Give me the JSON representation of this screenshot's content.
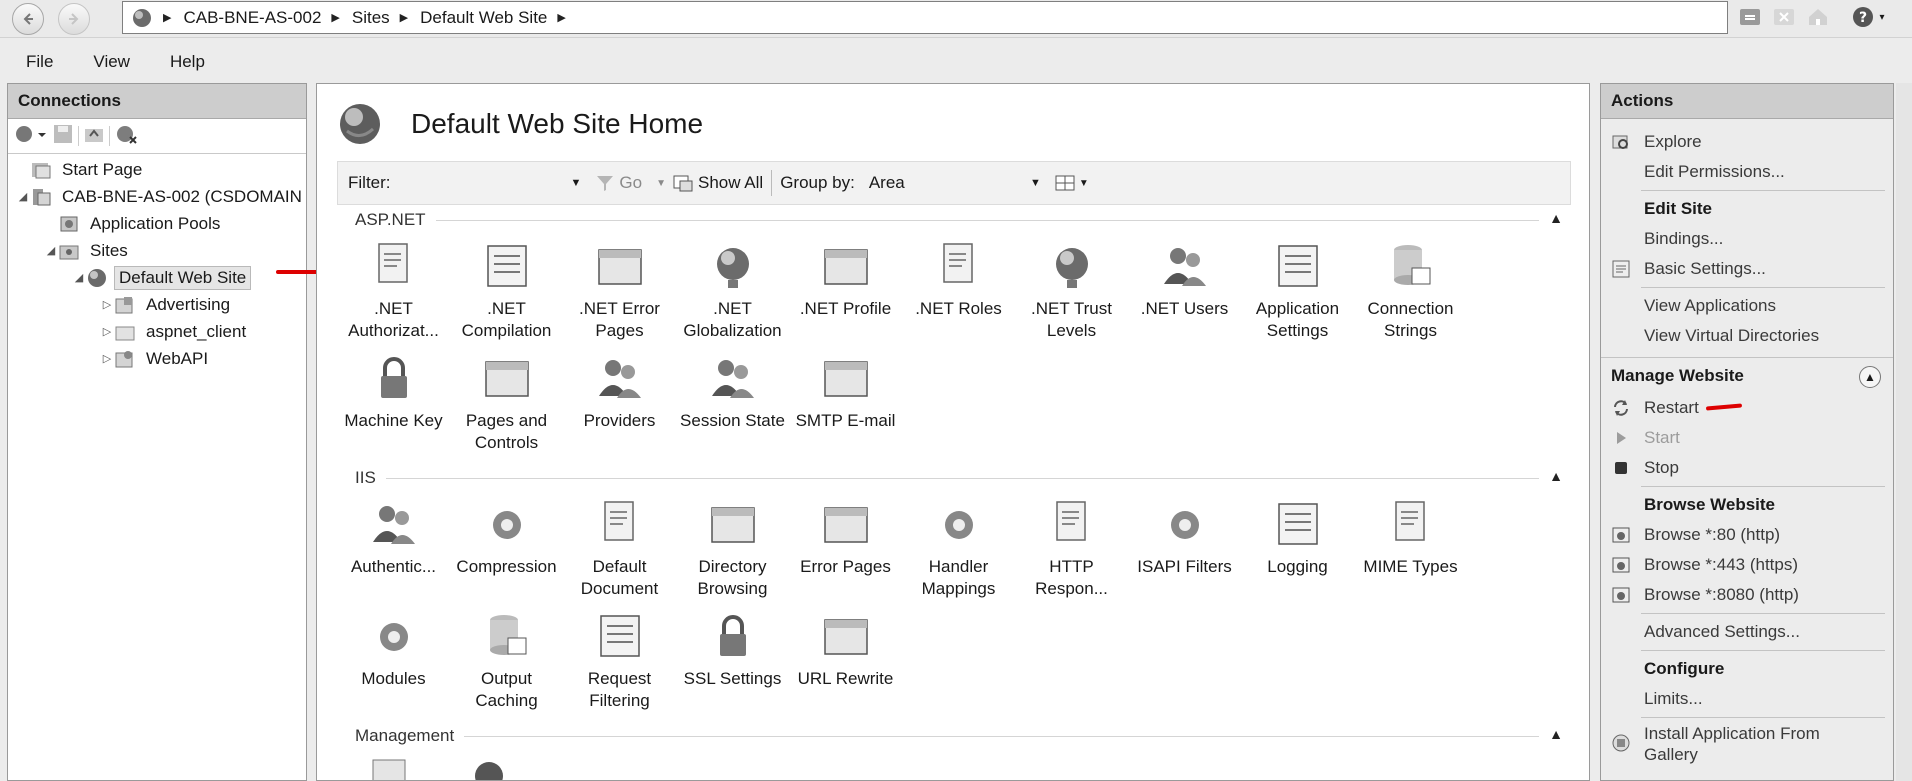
{
  "address": {
    "crumbs": [
      "CAB-BNE-AS-002",
      "Sites",
      "Default Web Site"
    ]
  },
  "menu": [
    "File",
    "View",
    "Help"
  ],
  "connections": {
    "title": "Connections",
    "tree": [
      {
        "label": "Start Page",
        "icon": "start-page-icon",
        "level": 0,
        "twisty": ""
      },
      {
        "label": "CAB-BNE-AS-002 (CSDOMAIN",
        "icon": "server-icon",
        "level": 0,
        "twisty": "◢"
      },
      {
        "label": "Application Pools",
        "icon": "app-pool-icon",
        "level": 1,
        "twisty": ""
      },
      {
        "label": "Sites",
        "icon": "sites-folder-icon",
        "level": 1,
        "twisty": "◢"
      },
      {
        "label": "Default Web Site",
        "icon": "globe-icon",
        "level": 2,
        "twisty": "◢",
        "selected": true
      },
      {
        "label": "Advertising",
        "icon": "app-folder-icon",
        "level": 3,
        "twisty": "▷"
      },
      {
        "label": "aspnet_client",
        "icon": "folder-icon",
        "level": 3,
        "twisty": "▷"
      },
      {
        "label": "WebAPI",
        "icon": "app-folder-icon",
        "level": 3,
        "twisty": "▷"
      }
    ]
  },
  "center": {
    "title": "Default Web Site Home",
    "filter": {
      "label": "Filter:",
      "go": "Go",
      "show_all": "Show All",
      "group_by_label": "Group by:",
      "group_by_value": "Area"
    },
    "groups": [
      {
        "name": "ASP.NET",
        "features": [
          {
            "label": ".NET Authorizat...",
            "icon": "net-authorization-icon"
          },
          {
            "label": ".NET Compilation",
            "icon": "net-compilation-icon"
          },
          {
            "label": ".NET Error Pages",
            "icon": "net-error-pages-icon"
          },
          {
            "label": ".NET Globalization",
            "icon": "net-globalization-icon"
          },
          {
            "label": ".NET Profile",
            "icon": "net-profile-icon"
          },
          {
            "label": ".NET Roles",
            "icon": "net-roles-icon"
          },
          {
            "label": ".NET Trust Levels",
            "icon": "net-trust-levels-icon"
          },
          {
            "label": ".NET Users",
            "icon": "net-users-icon"
          },
          {
            "label": "Application Settings",
            "icon": "application-settings-icon"
          },
          {
            "label": "Connection Strings",
            "icon": "connection-strings-icon"
          },
          {
            "label": "Machine Key",
            "icon": "machine-key-icon"
          },
          {
            "label": "Pages and Controls",
            "icon": "pages-controls-icon"
          },
          {
            "label": "Providers",
            "icon": "providers-icon"
          },
          {
            "label": "Session State",
            "icon": "session-state-icon"
          },
          {
            "label": "SMTP E-mail",
            "icon": "smtp-email-icon"
          }
        ]
      },
      {
        "name": "IIS",
        "features": [
          {
            "label": "Authentic...",
            "icon": "authentication-icon"
          },
          {
            "label": "Compression",
            "icon": "compression-icon"
          },
          {
            "label": "Default Document",
            "icon": "default-document-icon"
          },
          {
            "label": "Directory Browsing",
            "icon": "directory-browsing-icon"
          },
          {
            "label": "Error Pages",
            "icon": "error-pages-icon"
          },
          {
            "label": "Handler Mappings",
            "icon": "handler-mappings-icon"
          },
          {
            "label": "HTTP Respon...",
            "icon": "http-response-icon"
          },
          {
            "label": "ISAPI Filters",
            "icon": "isapi-filters-icon"
          },
          {
            "label": "Logging",
            "icon": "logging-icon"
          },
          {
            "label": "MIME Types",
            "icon": "mime-types-icon"
          },
          {
            "label": "Modules",
            "icon": "modules-icon"
          },
          {
            "label": "Output Caching",
            "icon": "output-caching-icon"
          },
          {
            "label": "Request Filtering",
            "icon": "request-filtering-icon"
          },
          {
            "label": "SSL Settings",
            "icon": "ssl-settings-icon"
          },
          {
            "label": "URL Rewrite",
            "icon": "url-rewrite-icon"
          }
        ]
      },
      {
        "name": "Management",
        "features": []
      }
    ]
  },
  "actions": {
    "title": "Actions",
    "top": [
      {
        "label": "Explore",
        "icon": "explore-icon"
      },
      {
        "label": "Edit Permissions...",
        "icon": ""
      }
    ],
    "edit_site_title": "Edit Site",
    "edit_site": [
      {
        "label": "Bindings...",
        "icon": ""
      },
      {
        "label": "Basic Settings...",
        "icon": "basic-settings-icon"
      }
    ],
    "view": [
      {
        "label": "View Applications",
        "icon": ""
      },
      {
        "label": "View Virtual Directories",
        "icon": ""
      }
    ],
    "manage_title": "Manage Website",
    "manage": [
      {
        "label": "Restart",
        "icon": "restart-icon",
        "disabled": false
      },
      {
        "label": "Start",
        "icon": "start-icon",
        "disabled": true
      },
      {
        "label": "Stop",
        "icon": "stop-icon",
        "disabled": false
      }
    ],
    "browse_title": "Browse Website",
    "browse": [
      {
        "label": "Browse *:80 (http)",
        "icon": "browse-icon"
      },
      {
        "label": "Browse *:443 (https)",
        "icon": "browse-icon"
      },
      {
        "label": "Browse *:8080 (http)",
        "icon": "browse-icon"
      }
    ],
    "advanced": "Advanced Settings...",
    "configure_title": "Configure",
    "limits": "Limits...",
    "install": "Install Application From Gallery"
  }
}
